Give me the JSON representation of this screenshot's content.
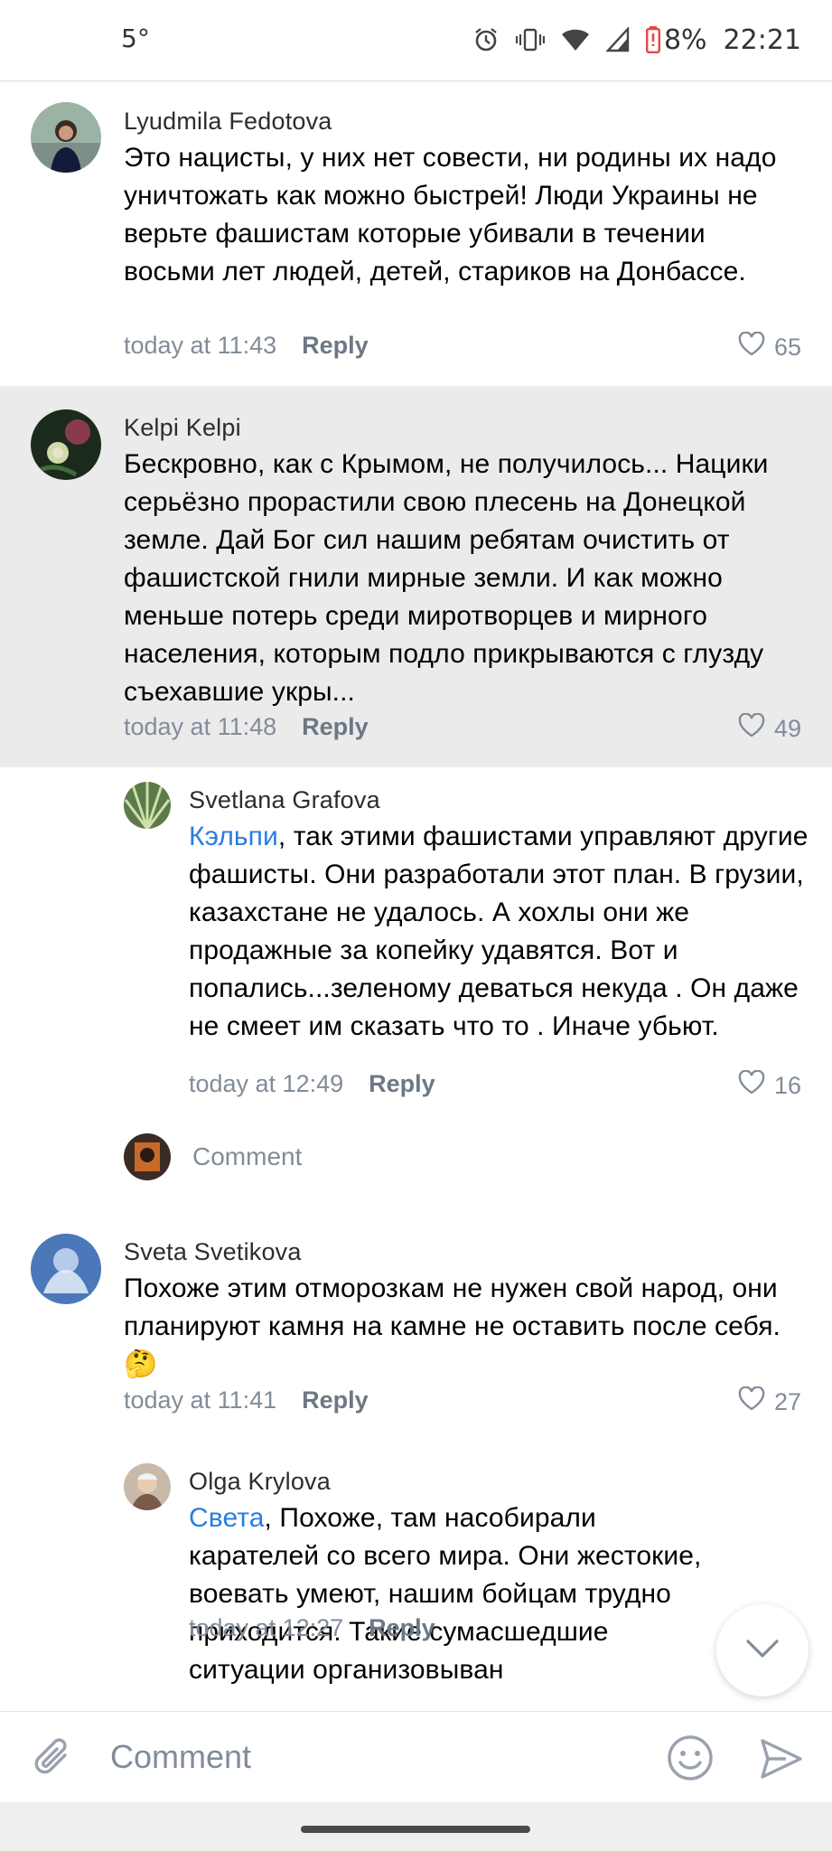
{
  "status_bar": {
    "temperature": "5°",
    "battery": "8%",
    "time": "22:21",
    "icons": [
      "alarm-icon",
      "vibrate-icon",
      "wifi-icon",
      "signal-icon",
      "battery-low-icon"
    ]
  },
  "comments": [
    {
      "author": "Lyudmila Fedotova",
      "text": "Это нацисты, у них нет совести, ни родины их надо уничтожать как можно быстрей! Люди Украины не верьте фашистам которые убивали в течении восьми лет людей, детей, стариков на Донбассе.",
      "time": "today at 11:43",
      "reply": "Reply",
      "likes": "65"
    },
    {
      "author": "Kelpi Kelpi",
      "text": "Бескровно, как с Крымом, не получилось... Нацики серьёзно прорастили свою плесень на Донецкой земле. Дай Бог сил нашим ребятам очистить от фашистской гнили мирные земли. И как можно меньше потерь среди миротворцев и мирного населения, которым подло прикрываются с глузду съехавшие укры...",
      "time": "today at 11:48",
      "reply": "Reply",
      "likes": "49"
    },
    {
      "author": "Svetlana Grafova",
      "mention": "Кэльпи",
      "text": ", так этими фашистами управляют другие фашисты. Они разработали этот план. В грузии, казахстане не удалось. А хохлы они же продажные за копейку удавятся. Вот и попались...зеленому деваться некуда . Он даже не смеет  им сказать что то . Иначе убьют.",
      "time": "today at 12:49",
      "reply": "Reply",
      "likes": "16"
    },
    {
      "author": "Sveta Svetikova",
      "text": "Похоже этим отморозкам не нужен свой народ, они планируют камня на камне не оставить после себя.",
      "emoji": "🤔",
      "time": "today at 11:41",
      "reply": "Reply",
      "likes": "27"
    },
    {
      "author": "Olga Krylova",
      "mention": "Света",
      "text": ", Похоже, там насобирали карателей со всего мира. Они жестокие, воевать умеют, нашим бойцам трудно приходится. Такие сумасшедшие ситуации организовыван",
      "time": "today at 12:27",
      "reply": "Reply"
    }
  ],
  "thread_comment_prompt": "Comment",
  "composer": {
    "placeholder": "Comment"
  },
  "colors": {
    "accent": "#2a7de1",
    "meta": "#818c99",
    "highlight": "#ebebeb"
  }
}
